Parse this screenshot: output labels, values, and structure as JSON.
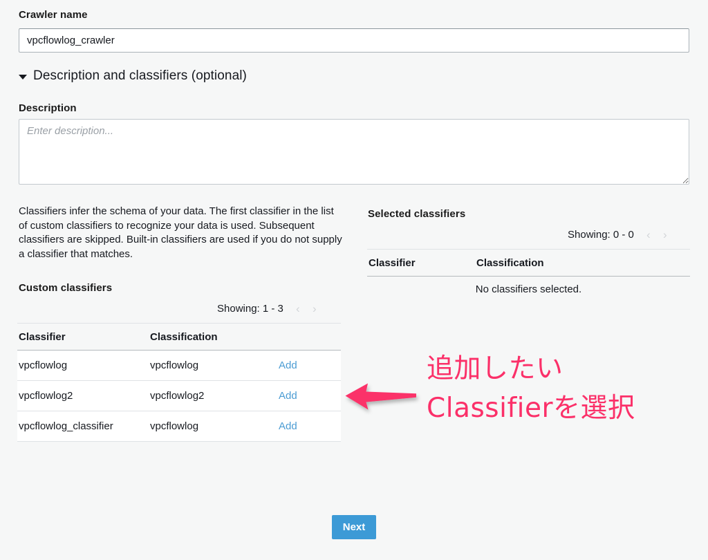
{
  "colors": {
    "page_background": "#f6f7f7",
    "accent_link": "#4b9cd3",
    "primary_button": "#3c9ad6",
    "annotation_pink": "#fb3069",
    "text": "#16191f"
  },
  "form": {
    "crawler_name_label": "Crawler name",
    "crawler_name_value": "vpcflowlog_crawler",
    "crawler_name_placeholder": "",
    "disclosure_label": "Description and classifiers (optional)",
    "description_label": "Description",
    "description_value": "",
    "description_placeholder": "Enter description..."
  },
  "help": {
    "classifier_help": "Classifiers infer the schema of your data. The first classifier in the list of custom classifiers to recognize your data is used. Subsequent classifiers are skipped. Built-in classifiers are used if you do not supply a classifier that matches."
  },
  "custom_classifiers": {
    "heading": "Custom classifiers",
    "showing": "Showing: 1 - 3",
    "prev_icon": "‹",
    "next_icon": "›",
    "columns": [
      "Classifier",
      "Classification"
    ],
    "rows": [
      {
        "classifier": "vpcflowlog",
        "classification": "vpcflowlog",
        "action": "Add"
      },
      {
        "classifier": "vpcflowlog2",
        "classification": "vpcflowlog2",
        "action": "Add"
      },
      {
        "classifier": "vpcflowlog_classifier",
        "classification": "vpcflowlog",
        "action": "Add"
      }
    ]
  },
  "selected_classifiers": {
    "heading": "Selected classifiers",
    "showing": "Showing: 0 - 0",
    "prev_icon": "‹",
    "next_icon": "›",
    "columns": [
      "Classifier",
      "Classification"
    ],
    "empty_message": "No classifiers selected."
  },
  "annotation": {
    "text": "追加したい\nClassifierを選択",
    "arrow_direction": "left"
  },
  "footer": {
    "next_label": "Next"
  }
}
